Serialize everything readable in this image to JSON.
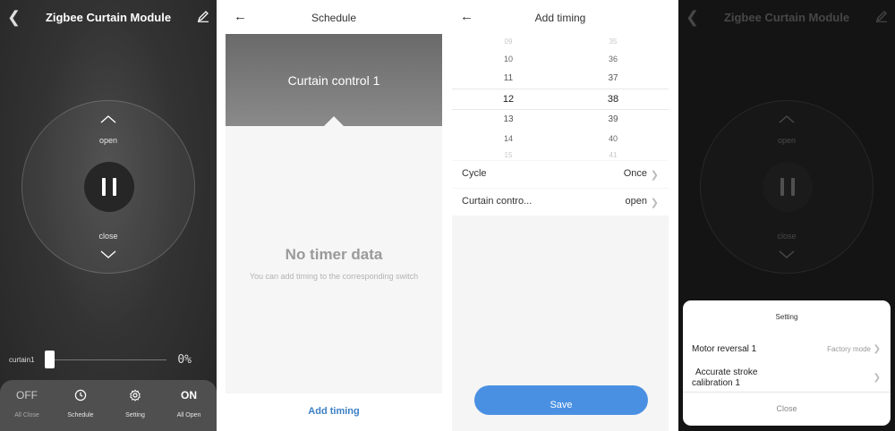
{
  "panel_control": {
    "title": "Zigbee Curtain Module",
    "open_label": "open",
    "close_label": "close",
    "curtain_name": "curtain1",
    "position_readout": "0%",
    "bottom_bar": {
      "all_close_icon": "OFF",
      "all_close_label": "All Close",
      "schedule_label": "Schedule",
      "setting_label": "Setting",
      "all_open_icon": "ON",
      "all_open_label": "All Open"
    }
  },
  "panel_schedule": {
    "title": "Schedule",
    "banner_name": "Curtain control 1",
    "empty_title": "No timer data",
    "empty_subtitle": "You can add timing to the corresponding switch",
    "add_timing_label": "Add timing"
  },
  "panel_add_timing": {
    "title": "Add timing",
    "hours": [
      "09",
      "10",
      "11",
      "12",
      "13",
      "14",
      "15"
    ],
    "minutes": [
      "35",
      "36",
      "37",
      "38",
      "39",
      "40",
      "41"
    ],
    "selected_hour": "12",
    "selected_minute": "38",
    "cycle_label": "Cycle",
    "cycle_value": "Once",
    "curtain_control_label": "Curtain contro...",
    "curtain_control_value": "open",
    "save_label": "Save"
  },
  "panel_setting": {
    "title": "Zigbee Curtain Module",
    "open_label": "open",
    "close_label": "close",
    "sheet_title": "Setting",
    "motor_reversal_label": "Motor reversal 1",
    "motor_reversal_value": "Factory mode",
    "stroke_calibration_label_line1": "Accurate stroke",
    "stroke_calibration_label_line2": "calibration 1",
    "close_label_button": "Close"
  },
  "colors": {
    "accent_blue": "#4a90e2",
    "link_blue": "#3b7fc4",
    "dark_bg": "#262626"
  }
}
